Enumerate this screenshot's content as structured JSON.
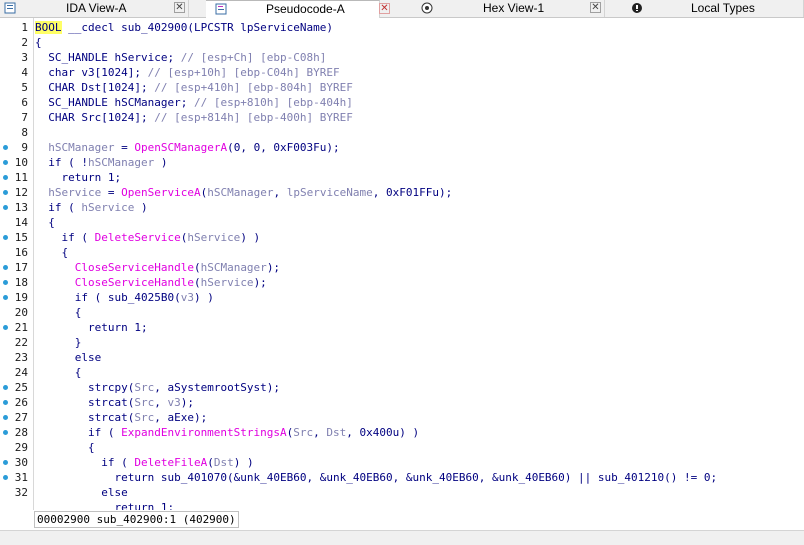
{
  "tabs": [
    {
      "label": "IDA View-A",
      "icon": "ida-view-icon",
      "active": false
    },
    {
      "label": "Pseudocode-A",
      "icon": "pseudocode-icon",
      "active": true
    },
    {
      "label": "Hex View-1",
      "icon": "hex-view-icon",
      "active": false
    },
    {
      "label": "Local Types",
      "icon": "local-types-icon",
      "active": false
    }
  ],
  "close_glyph": "✕",
  "lines": [
    {
      "n": "1",
      "bp": false,
      "t": [
        [
          "kw",
          "BOOL"
        ],
        [
          "p",
          " __cdecl sub_402900(LPCSTR lpServiceName)"
        ]
      ]
    },
    {
      "n": "2",
      "bp": false,
      "t": [
        [
          "p",
          "{"
        ]
      ]
    },
    {
      "n": "3",
      "bp": false,
      "t": [
        [
          "p",
          "  SC_HANDLE hService; "
        ],
        [
          "c",
          "// [esp+Ch] [ebp-C08h]"
        ]
      ]
    },
    {
      "n": "4",
      "bp": false,
      "t": [
        [
          "p",
          "  char v3[1024]; "
        ],
        [
          "c",
          "// [esp+10h] [ebp-C04h] BYREF"
        ]
      ]
    },
    {
      "n": "5",
      "bp": false,
      "t": [
        [
          "p",
          "  CHAR Dst[1024]; "
        ],
        [
          "c",
          "// [esp+410h] [ebp-804h] BYREF"
        ]
      ]
    },
    {
      "n": "6",
      "bp": false,
      "t": [
        [
          "p",
          "  SC_HANDLE hSCManager; "
        ],
        [
          "c",
          "// [esp+810h] [ebp-404h]"
        ]
      ]
    },
    {
      "n": "7",
      "bp": false,
      "t": [
        [
          "p",
          "  CHAR Src[1024]; "
        ],
        [
          "c",
          "// [esp+814h] [ebp-400h] BYREF"
        ]
      ]
    },
    {
      "n": "8",
      "bp": false,
      "t": []
    },
    {
      "n": "9",
      "bp": true,
      "t": [
        [
          "v",
          "  hSCManager"
        ],
        [
          "p",
          " = "
        ],
        [
          "f",
          "OpenSCManagerA"
        ],
        [
          "p",
          "(0, 0, 0xF003Fu);"
        ]
      ]
    },
    {
      "n": "10",
      "bp": true,
      "t": [
        [
          "p",
          "  if ( !"
        ],
        [
          "v",
          "hSCManager"
        ],
        [
          "p",
          " )"
        ]
      ]
    },
    {
      "n": "11",
      "bp": true,
      "t": [
        [
          "p",
          "    return 1;"
        ]
      ]
    },
    {
      "n": "12",
      "bp": true,
      "t": [
        [
          "v",
          "  hService"
        ],
        [
          "p",
          " = "
        ],
        [
          "f",
          "OpenServiceA"
        ],
        [
          "p",
          "("
        ],
        [
          "v",
          "hSCManager"
        ],
        [
          "p",
          ", "
        ],
        [
          "v",
          "lpServiceName"
        ],
        [
          "p",
          ", 0xF01FFu);"
        ]
      ]
    },
    {
      "n": "13",
      "bp": true,
      "t": [
        [
          "p",
          "  if ( "
        ],
        [
          "v",
          "hService"
        ],
        [
          "p",
          " )"
        ]
      ]
    },
    {
      "n": "14",
      "bp": false,
      "t": [
        [
          "p",
          "  {"
        ]
      ]
    },
    {
      "n": "15",
      "bp": true,
      "t": [
        [
          "p",
          "    if ( "
        ],
        [
          "f",
          "DeleteService"
        ],
        [
          "p",
          "("
        ],
        [
          "v",
          "hService"
        ],
        [
          "p",
          ") )"
        ]
      ]
    },
    {
      "n": "16",
      "bp": false,
      "t": [
        [
          "p",
          "    {"
        ]
      ]
    },
    {
      "n": "17",
      "bp": true,
      "t": [
        [
          "f",
          "      CloseServiceHandle"
        ],
        [
          "p",
          "("
        ],
        [
          "v",
          "hSCManager"
        ],
        [
          "p",
          ");"
        ]
      ]
    },
    {
      "n": "18",
      "bp": true,
      "t": [
        [
          "f",
          "      CloseServiceHandle"
        ],
        [
          "p",
          "("
        ],
        [
          "v",
          "hService"
        ],
        [
          "p",
          ");"
        ]
      ]
    },
    {
      "n": "19",
      "bp": true,
      "t": [
        [
          "p",
          "      if ( sub_4025B0("
        ],
        [
          "v",
          "v3"
        ],
        [
          "p",
          ") )"
        ]
      ]
    },
    {
      "n": "20",
      "bp": false,
      "t": [
        [
          "p",
          "      {"
        ]
      ]
    },
    {
      "n": "21",
      "bp": true,
      "t": [
        [
          "p",
          "        return 1;"
        ]
      ]
    },
    {
      "n": "22",
      "bp": false,
      "t": [
        [
          "p",
          "      }"
        ]
      ]
    },
    {
      "n": "23",
      "bp": false,
      "t": [
        [
          "p",
          "      else"
        ]
      ]
    },
    {
      "n": "24",
      "bp": false,
      "t": [
        [
          "p",
          "      {"
        ]
      ]
    },
    {
      "n": "25",
      "bp": true,
      "t": [
        [
          "p",
          "        strcpy("
        ],
        [
          "v",
          "Src"
        ],
        [
          "p",
          ", aSystemrootSyst);"
        ]
      ]
    },
    {
      "n": "26",
      "bp": true,
      "t": [
        [
          "p",
          "        strcat("
        ],
        [
          "v",
          "Src"
        ],
        [
          "p",
          ", "
        ],
        [
          "v",
          "v3"
        ],
        [
          "p",
          ");"
        ]
      ]
    },
    {
      "n": "27",
      "bp": true,
      "t": [
        [
          "p",
          "        strcat("
        ],
        [
          "v",
          "Src"
        ],
        [
          "p",
          ", aExe);"
        ]
      ]
    },
    {
      "n": "28",
      "bp": true,
      "t": [
        [
          "p",
          "        if ( "
        ],
        [
          "f",
          "ExpandEnvironmentStringsA"
        ],
        [
          "p",
          "("
        ],
        [
          "v",
          "Src"
        ],
        [
          "p",
          ", "
        ],
        [
          "v",
          "Dst"
        ],
        [
          "p",
          ", 0x400u) )"
        ]
      ]
    },
    {
      "n": "29",
      "bp": false,
      "t": [
        [
          "p",
          "        {"
        ]
      ]
    },
    {
      "n": "30",
      "bp": true,
      "t": [
        [
          "p",
          "          if ( "
        ],
        [
          "f",
          "DeleteFileA"
        ],
        [
          "p",
          "("
        ],
        [
          "v",
          "Dst"
        ],
        [
          "p",
          ") )"
        ]
      ]
    },
    {
      "n": "31",
      "bp": true,
      "t": [
        [
          "p",
          "            return sub_401070(&unk_40EB60, &unk_40EB60, &unk_40EB60, &unk_40EB60) || sub_401210() != 0;"
        ]
      ]
    },
    {
      "n": "32",
      "bp": false,
      "t": [
        [
          "p",
          "          else"
        ]
      ]
    },
    {
      "n": "",
      "bp": false,
      "t": [
        [
          "p",
          "            return 1;"
        ]
      ]
    }
  ],
  "status": {
    "text": "00002900 sub_402900:1 (402900)"
  },
  "colors": {
    "comment": "#8080b0",
    "function": "#e000e0",
    "variable": "#8080b0",
    "plain": "#000080",
    "keyword_bg": "#ffff66",
    "breakpoint": "#2b9cd8"
  }
}
